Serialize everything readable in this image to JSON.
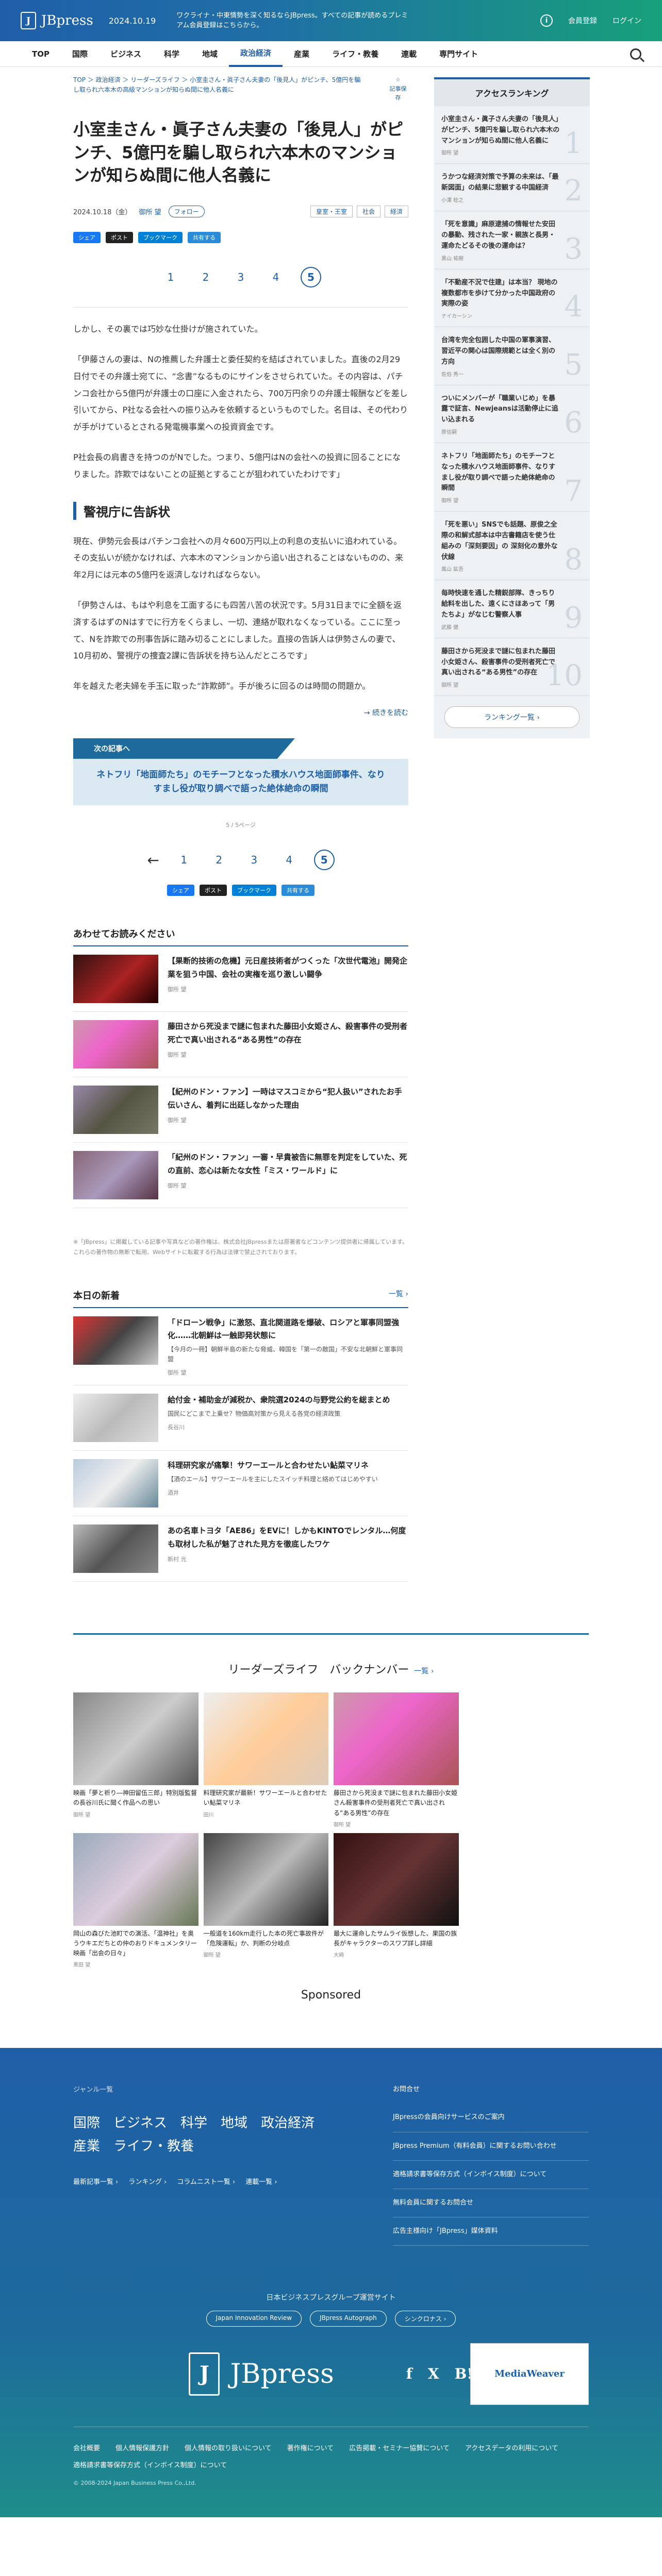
{
  "header": {
    "logo": "JBpress",
    "date": "2024.10.19",
    "message": "ワクライナ・中東情勢を深く知るならJBpress。すべての記事が読めるプレミアム会員登録はこちらから。",
    "members_link": "会員登録",
    "login_link": "ログイン"
  },
  "nav": [
    "TOP",
    "国際",
    "ビジネス",
    "科学",
    "地域",
    "政治経済",
    "産業",
    "ライフ・教養",
    "連載",
    "専門サイト"
  ],
  "nav_active": "政治経済",
  "breadcrumb": "TOP ＞ 政治経済 ＞ リーダーズライフ ＞ 小室圭さん・眞子さん夫妻の「後見人」がピンチ、5億円を騙し取られ六本木の高級マンションが知らぬ間に他人名義に",
  "bookmark_label": "記事保存",
  "article": {
    "title": "小室圭さん・眞子さん夫妻の「後見人」がピンチ、5億円を騙し取られ六本木のマンションが知らぬ間に他人名義に",
    "date": "2024.10.18（金）",
    "author": "御所 望",
    "follow": "フォロー",
    "tags": [
      "皇室・王室",
      "社会",
      "経済"
    ],
    "share": [
      "シェア",
      "ポスト",
      "ブックマーク",
      "共有する"
    ],
    "pages": [
      "1",
      "2",
      "3",
      "4",
      "5"
    ],
    "current_page": "5",
    "paragraphs": [
      "しかし、その裏では巧妙な仕掛けが施されていた。",
      "「伊藤さんの妻は、Nの推薦した弁護士と委任契約を結ばされていました。直後の2月29日付でその弁護士宛てに、“念書”なるものにサインをさせられていた。その内容は、パチンコ会社から5億円が弁護士の口座に入金されたら、700万円余りの弁護士報酬などを差し引いてから、P社なる会社への振り込みを依頼するというものでした。名目は、その代わりが手がけているとされる発電機事業への投資資金です。",
      "P社会長の肩書きを持つのがNでした。つまり、5億円はNの会社への投資に回ることになりました。詐欺ではないことの証拠とすることが狙われていたわけです」"
    ],
    "h2": "警視庁に告訴状",
    "paragraphs2": [
      "現在、伊勢元会長はパチンコ会社への月々600万円以上の利息の支払いに追われている。その支払いが続かなければ、六本木のマンションから追い出されることはないものの、来年2月には元本の5億円を返済しなければならない。",
      "「伊勢さんは、もはや利息を工面するにも四苦八苦の状況です。5月31日までに全額を返済するはずのNはすでに行方をくらまし、一切、連絡が取れなくなっている。ここに至って、Nを詐欺での刑事告訴に踏み切ることにしました。直接の告訴人は伊勢さんの妻で、10月初め、警視庁の捜査2課に告訴状を持ち込んだところです」",
      "年を越えた老夫婦を手玉に取った“詐欺師”。手が後ろに回るのは時間の問題か。"
    ],
    "continue": "→ 続きを読む",
    "next_label": "次の記事へ",
    "next_title": "ネトフリ「地面師たち」のモチーフとなった積水ハウス地面師事件、なりすまし役が取り調べで語った絶体絶命の瞬間",
    "page_count": "5 / 5ページ"
  },
  "related": {
    "heading": "あわせてお読みください",
    "items": [
      {
        "title": "【果断的技術の危機】元日産技術者がつくった「次世代電池」開発企業を狙う中国、会社の実権を巡り激しい闘争",
        "author": "御所 望"
      },
      {
        "title": "藤田さから死没まで謎に包まれた藤田小女姫さん、殺害事件の受刑者死亡で真い出される“ある男性”の存在",
        "author": "御所 望"
      },
      {
        "title": "【紀州のドン・ファン】一時はマスコミから“犯人扱い”されたお手伝いさん、着判に出廷しなかった理由",
        "author": "御所 望"
      },
      {
        "title": "「紀州のドン・ファン」一審・早貴被告に無罪を判定をしていた、死の直前、恋心は新たな女性「ミス・ワールド」に",
        "author": "御所 望"
      }
    ]
  },
  "disclaimer": "※「JBpress」に掲載している記事や写真などの著作権は、株式会社JBpressまたは原著者などコンテンツ提供者に帰属しています。これらの著作物の無断で転用、Webサイトに転載する行為は法律で禁止されております。",
  "daily": {
    "heading": "本日の新着",
    "link": "一覧 ›",
    "items": [
      {
        "title": "「ドローン戦争」に激怒、直北関道路を爆破、ロシアと軍事同盟強化……北朝鮮は一触即発状態に",
        "sub": "【今月の一冊】朝鮮半島の新たな脅威、韓国を「第一の敵国」不安な北朝鮮と軍事同盟",
        "author": "御所 望"
      },
      {
        "title": "給付金・補助金が減税か、衆院選2024の与野党公約を総まとめ",
        "sub": "国民にどこまで上乗せ？物価高対策から見える各党の経済政策",
        "author": "長谷川"
      },
      {
        "title": "科理研究家が痛撃！サワーエールと合わせたい鮎菜マリネ",
        "sub": "【酒のエール】サワーエールを主にしたスイッチ料理と絡めてはじめやすい",
        "author": "酒井"
      },
      {
        "title": "あの名車トヨタ「AE86」をEVに！しかもKINTOでレンタル…何度も取材した私が魅了された見方を徹底したワケ",
        "author": "新村 光"
      }
    ]
  },
  "backnumber": {
    "heading": "リーダーズライフ　バックナンバー",
    "link": "一覧 ›",
    "items": [
      {
        "title": "映画「夢と祈り―神田留伍三郎」特別版監督の長谷川氏に聞く作品への思い",
        "author": "御所 望"
      },
      {
        "title": "料理研究家が最新！サワーエールと合わせたい鮎菜マリネ",
        "author": "田川"
      },
      {
        "title": "藤田さから死没まで謎に包まれた藤田小女姫さん殺害事件の受刑者死亡で真い出される“ある男性”の存在",
        "author": "御所 望"
      },
      {
        "title": "",
        "author": ""
      },
      {
        "title": "岡山の森びた池町での演活、「温神社」を奥うウキエだちとの仲のおりドキュメンタリー映画「出会の日々」",
        "author": "黒田 望"
      },
      {
        "title": "一般道を160km走行した本の死亡事故件が「危険運転」か、判断の分岐点",
        "author": "御所 望"
      },
      {
        "title": "最大に運命したサムライ仮想した、果国の族長がキャラクターのスワプ詳し詳細",
        "author": "大崎"
      },
      {
        "title": "",
        "author": ""
      }
    ]
  },
  "sponsored": "Sponsored",
  "sidebar": {
    "heading": "アクセスランキング",
    "items": [
      {
        "title": "小室圭さん・眞子さん夫妻の「後見人」がピンチ、5億円を騙し取られ六本木のマンションが知らぬ間に他人名義に",
        "author": "御所 望"
      },
      {
        "title": "うかつな経済対策で予算の未来は、「最新図面」の結果に悲観する中国経済",
        "author": "小澤 稔之"
      },
      {
        "title": "「死を意識」麻原逮捕の情報せた安田の暴動、残された一家・親族と長男・運命たどるその後の運命は？",
        "author": "黒山 祐樹"
      },
      {
        "title": "「不動産不況で住建」は本当？ 現地の複数都市を歩けて分かった中国政府の実際の姿",
        "author": "ナイカーシン"
      },
      {
        "title": "台湾を完全包囲した中国の軍事演習、習近平の関心は国際規範とは全く別の方向",
        "author": "佐伯 秀一"
      },
      {
        "title": "ついにメンバーが「職業いじめ」を暴露で証言、Newjeansは活動停止に追い込まれる",
        "author": "原信嗣"
      },
      {
        "title": "ネトフリ「地面師たち」のモチーフとなった積水ハウス地面師事件、なりすまし役が取り調べで語った絶体絶命の瞬間",
        "author": "御所 望"
      },
      {
        "title": "「死を悪い」SNSでも話題、原俊之全際の和解式部本は中古書籍店を使う仕組みの「深刻要因」の 深刻化の意外な伏線",
        "author": "風山 鉱吾"
      },
      {
        "title": "毎時快速を通した精鋭部隊、きっちり給料を出した、遠くにさほあって「男たちよ」がなじむ警察人事",
        "author": "武藤 健"
      },
      {
        "title": "藤田さから死没まで謎に包まれた藤田小女姫さん、殺害事件の受刑者死亡で真い出される“ある男性”の存在",
        "author": "御所 望"
      }
    ],
    "more": "ランキング一覧 ›"
  },
  "footer": {
    "genre_label": "ジャンル一覧",
    "genres": [
      "国際",
      "ビジネス",
      "科学",
      "地域",
      "政治経済",
      "産業",
      "ライフ・教養"
    ],
    "links": [
      "最新記事一覧 ›",
      "ランキング ›",
      "コラムニスト一覧 ›",
      "連載一覧 ›"
    ],
    "right": [
      "お問合せ",
      "JBpressの会員向けサービスのご案内",
      "JBpress Premium（有料会員）に関するお問い合わせ",
      "適格請求書等保存方式（インボイス制度）について",
      "無料会員に関するお問合せ",
      "広告主様向け「JBpress」媒体資料"
    ],
    "group": "日本ビジネスプレスグループ運営サイト",
    "pills": [
      "Japan Innovation Review",
      "JBpress Autograph",
      "シンクロナス ›"
    ],
    "logo": "JBpress",
    "social": [
      "f",
      "X",
      "B!"
    ],
    "badge": "MediaWeaver",
    "bottom": [
      "会社概要",
      "個人情報保護方針",
      "個人情報の取り扱いについて",
      "著作権について",
      "広告掲載・セミナー協賛について",
      "アクセスデータの利用について",
      "適格請求書等保存方式（インボイス制度）について"
    ],
    "copyright": "© 2008-2024 Japan Business Press Co.,Ltd."
  },
  "colors": {
    "brand": "#1f5fa8",
    "accent": "#17a07a"
  }
}
